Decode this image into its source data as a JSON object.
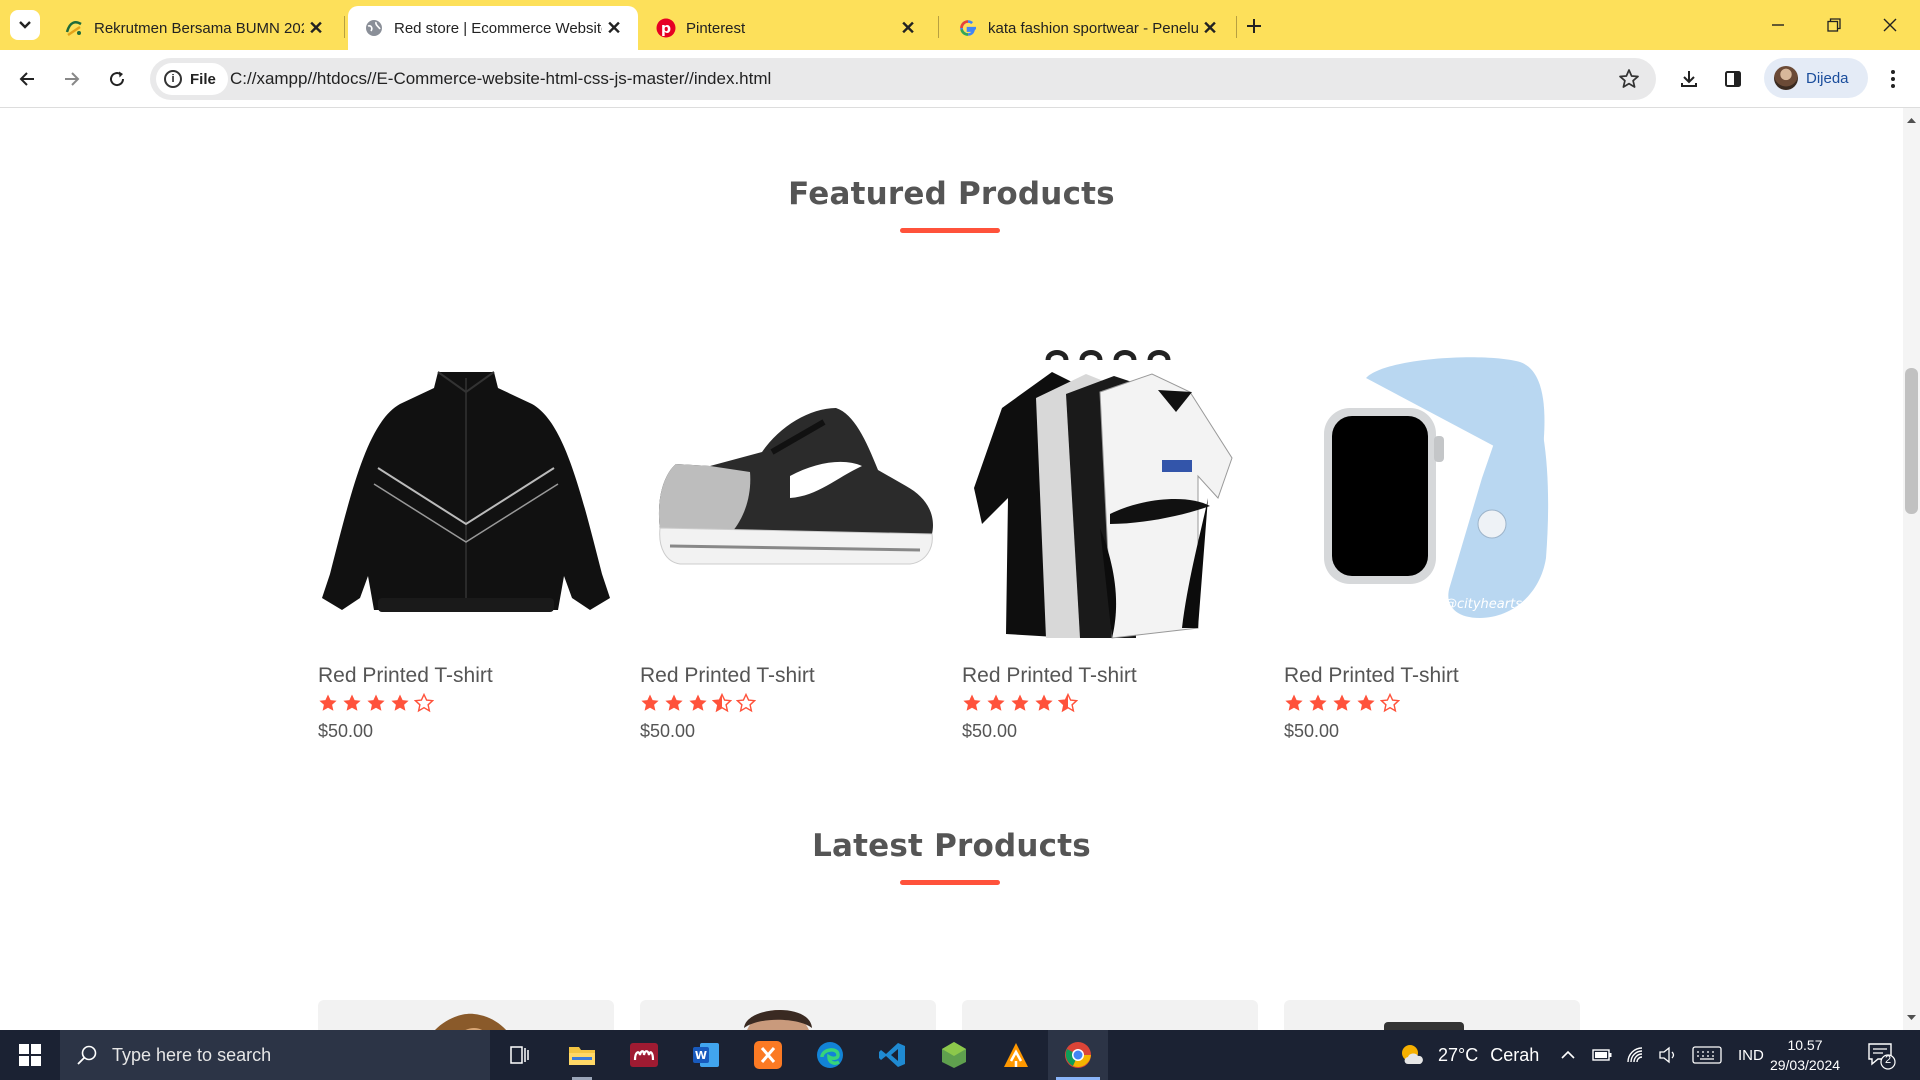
{
  "browser": {
    "tabs": [
      {
        "title": "Rekrutmen Bersama BUMN 202",
        "icon": "bumn-logo-icon",
        "active": false
      },
      {
        "title": "Red store | Ecommerce Website",
        "icon": "globe-icon",
        "active": true
      },
      {
        "title": "Pinterest",
        "icon": "pinterest-icon",
        "active": false
      },
      {
        "title": "kata fashion sportwear - Penelu",
        "icon": "google-icon",
        "active": false
      }
    ],
    "address": {
      "chip_label": "File",
      "url": "C://xampp//htdocs//E-Commerce-website-html-css-js-master//index.html"
    },
    "profile_name": "Dijeda"
  },
  "page": {
    "featured_title": "Featured Products",
    "latest_title": "Latest Products",
    "featured_products": [
      {
        "name": "Red Printed T-shirt",
        "price": "$50.00",
        "rating": 4,
        "image": "black-jacket"
      },
      {
        "name": "Red Printed T-shirt",
        "price": "$50.00",
        "rating": 3.5,
        "image": "sport-shoe"
      },
      {
        "name": "Red Printed T-shirt",
        "price": "$50.00",
        "rating": 4.5,
        "image": "jerseys-on-hangers"
      },
      {
        "name": "Red Printed T-shirt",
        "price": "$50.00",
        "rating": 4,
        "image": "smart-watch",
        "image_watermark": "@cityhearts"
      }
    ],
    "latest_products": [
      {
        "image": "brown-hoodie"
      },
      {
        "image": "man-portrait"
      },
      {
        "image": "blank"
      },
      {
        "image": "dark-item"
      }
    ],
    "accent_color": "#ff523b"
  },
  "taskbar": {
    "search_placeholder": "Type here to search",
    "apps": [
      "task-view-icon",
      "file-explorer-icon",
      "mendeley-icon",
      "word-icon",
      "xampp-icon",
      "edge-icon",
      "vscode-icon",
      "nodejs-icon",
      "sublime-icon",
      "chrome-icon"
    ],
    "weather": {
      "temp": "27°C",
      "condition": "Cerah"
    },
    "language": "IND",
    "time": "10.57",
    "date": "29/03/2024",
    "notification_count": "2"
  }
}
